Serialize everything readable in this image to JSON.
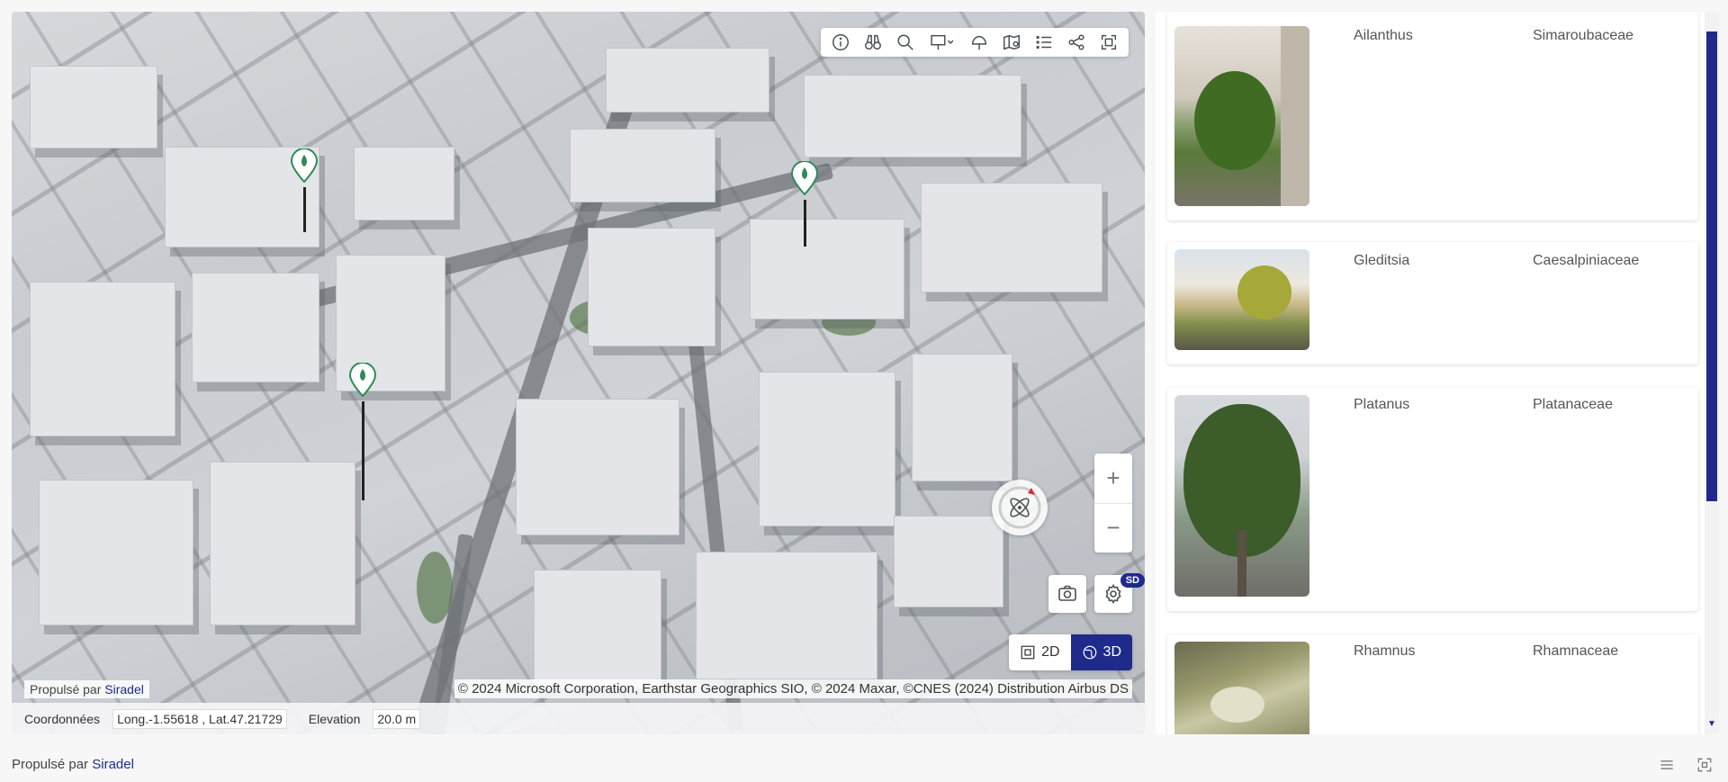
{
  "map": {
    "toolbar": {
      "icons": [
        "info-icon",
        "binoculars-icon",
        "search-icon",
        "presentation-icon",
        "tree-icon",
        "layers-map-icon",
        "list-icon",
        "share-icon",
        "fullscreen-icon"
      ]
    },
    "zoom": {
      "plus": "+",
      "minus": "−"
    },
    "badge": "SD",
    "view_toggle": {
      "option_2d": "2D",
      "option_3d": "3D",
      "active": "3D",
      "active_color": "#1f2a8a"
    },
    "attribution": "© 2024 Microsoft Corporation, Earthstar Geographics SIO, © 2024 Maxar, ©CNES (2024) Distribution Airbus DS",
    "powered_by": {
      "prefix": "Propulsé par",
      "link": "Siradel"
    },
    "coords": {
      "label": "Coordonnées",
      "value": "Long.-1.55618 , Lat.47.21729",
      "elevation_label": "Elevation",
      "elevation_value": "20.0 m"
    },
    "pin_color": "#2e8b57"
  },
  "list": {
    "items": [
      {
        "genus": "Ailanthus",
        "family": "Simaroubaceae"
      },
      {
        "genus": "Gleditsia",
        "family": "Caesalpiniaceae"
      },
      {
        "genus": "Platanus",
        "family": "Platanaceae"
      },
      {
        "genus": "Rhamnus",
        "family": "Rhamnaceae"
      }
    ]
  },
  "footer": {
    "powered_by": {
      "prefix": "Propulsé par",
      "link": "Siradel"
    }
  }
}
